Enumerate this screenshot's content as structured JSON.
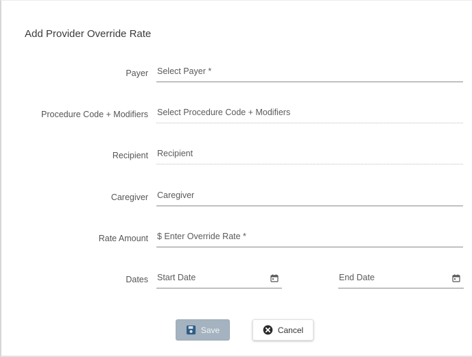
{
  "dialog": {
    "title": "Add Provider Override Rate"
  },
  "form": {
    "payer": {
      "label": "Payer",
      "placeholder": "Select Payer *"
    },
    "procedure": {
      "label": "Procedure Code + Modifiers",
      "placeholder": "Select Procedure Code + Modifiers"
    },
    "recipient": {
      "label": "Recipient",
      "placeholder": "Recipient"
    },
    "caregiver": {
      "label": "Caregiver",
      "placeholder": "Caregiver"
    },
    "rate_amount": {
      "label": "Rate Amount",
      "placeholder": "$ Enter Override Rate *"
    },
    "dates": {
      "label": "Dates",
      "start_placeholder": "Start Date",
      "end_placeholder": "End Date"
    }
  },
  "actions": {
    "save_label": "Save",
    "cancel_label": "Cancel",
    "save_icon": "floppy-disk-icon",
    "cancel_icon": "close-circle-icon"
  },
  "colors": {
    "save_button_bg": "#a4b3bf",
    "save_icon": "#2f5d86",
    "cancel_icon": "#2b2b2b"
  }
}
